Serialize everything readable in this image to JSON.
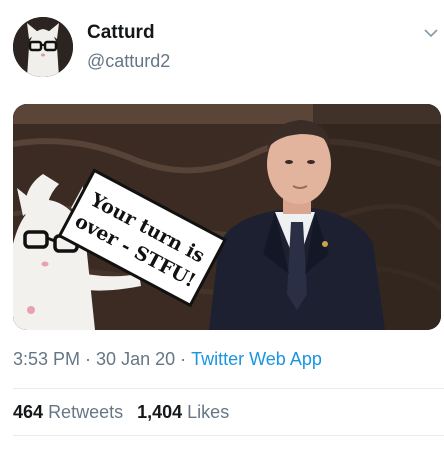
{
  "author": {
    "name": "Catturd",
    "handle": "@catturd2"
  },
  "media": {
    "overlay_sign_line1": "Your turn is",
    "overlay_sign_line2": "over - STFU!"
  },
  "meta": {
    "time": "3:53 PM",
    "separator": "·",
    "date": "30 Jan 20",
    "source": "Twitter Web App"
  },
  "stats": {
    "retweets_count": "464",
    "retweets_label": "Retweets",
    "likes_count": "1,404",
    "likes_label": "Likes"
  },
  "colors": {
    "link": "#1b95e0",
    "secondary_text": "#657786",
    "primary_text": "#14171a",
    "divider": "#e6ecf0"
  },
  "icons": {
    "more_menu": "chevron-down-icon"
  }
}
